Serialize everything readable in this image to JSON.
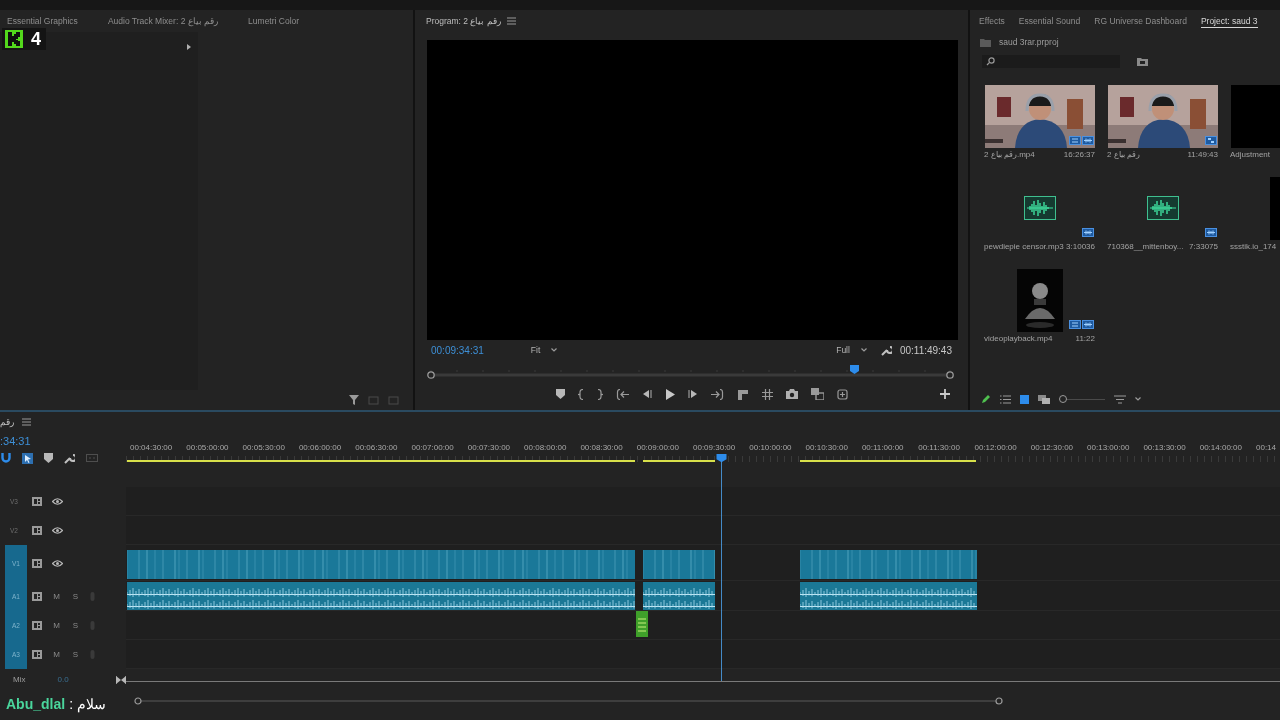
{
  "overlay": {
    "viewer_count": "4"
  },
  "left_panel": {
    "tabs": [
      {
        "label": "Essential Graphics",
        "selected": false
      },
      {
        "label": "Audio Track Mixer: رقم بياع 2",
        "selected": false
      },
      {
        "label": "Lumetri Color",
        "selected": false
      }
    ]
  },
  "program": {
    "title": "Program: رقم بياع 2",
    "timecode": "00:09:34:31",
    "zoom": "Fit",
    "resolution": "Full",
    "duration": "00:11:49:43",
    "scrubber": {
      "level": 0.81
    }
  },
  "project_panel": {
    "tabs": [
      {
        "label": "Effects",
        "selected": false
      },
      {
        "label": "Essential Sound",
        "selected": false
      },
      {
        "label": "RG Universe Dashboard",
        "selected": false
      },
      {
        "label": "Project: saud 3",
        "selected": true
      }
    ],
    "file": "saud 3rar.prproj",
    "zoom_slider": {
      "level": 0
    },
    "items": [
      {
        "kind": "clip",
        "name": "رقم بياع 2.mp4",
        "duration": "16:26:37"
      },
      {
        "kind": "sequence",
        "name": "رقم بياع 2",
        "duration": "11:49:43"
      },
      {
        "kind": "blank",
        "name": "Adjustment"
      },
      {
        "kind": "audio",
        "name": "pewdiepie censor.mp3",
        "duration": "3:10036"
      },
      {
        "kind": "audio",
        "name": "710368__mittenboy...",
        "duration": "7:33075"
      },
      {
        "kind": "blank-tall",
        "name": "ssstik.io_174"
      },
      {
        "kind": "portrait",
        "name": "videoplayback.mp4",
        "duration": "11:22"
      }
    ]
  },
  "timeline": {
    "title": "رقم",
    "timecode": ":34:31",
    "ruler": [
      "00:04:30:00",
      "00:05:00:00",
      "00:05:30:00",
      "00:06:00:00",
      "00:06:30:00",
      "00:07:00:00",
      "00:07:30:00",
      "00:08:00:00",
      "00:08:30:00",
      "00:09:00:00",
      "00:09:30:00",
      "00:10:00:00",
      "00:10:30:00",
      "00:11:00:00",
      "00:11:30:00",
      "00:12:00:00",
      "00:12:30:00",
      "00:13:00:00",
      "00:13:30:00",
      "00:14:00:00",
      "00:14"
    ],
    "playhead": {
      "level": 0.516
    },
    "tracks": [
      {
        "label": "V3",
        "kind": "video",
        "targeted": false
      },
      {
        "label": "V2",
        "kind": "video",
        "targeted": false
      },
      {
        "label": "V1",
        "kind": "video",
        "targeted": true
      },
      {
        "label": "A1",
        "kind": "audio",
        "targeted": true,
        "mute": "M",
        "solo": "S"
      },
      {
        "label": "A2",
        "kind": "audio",
        "targeted": true,
        "mute": "M",
        "solo": "S"
      },
      {
        "label": "A3",
        "kind": "audio",
        "targeted": true,
        "mute": "M",
        "solo": "S"
      }
    ],
    "mix": {
      "label": "Mix",
      "value": "0.0"
    }
  },
  "chat": {
    "user": "Abu_dlal",
    "separator": ":",
    "message": "سلام"
  }
}
